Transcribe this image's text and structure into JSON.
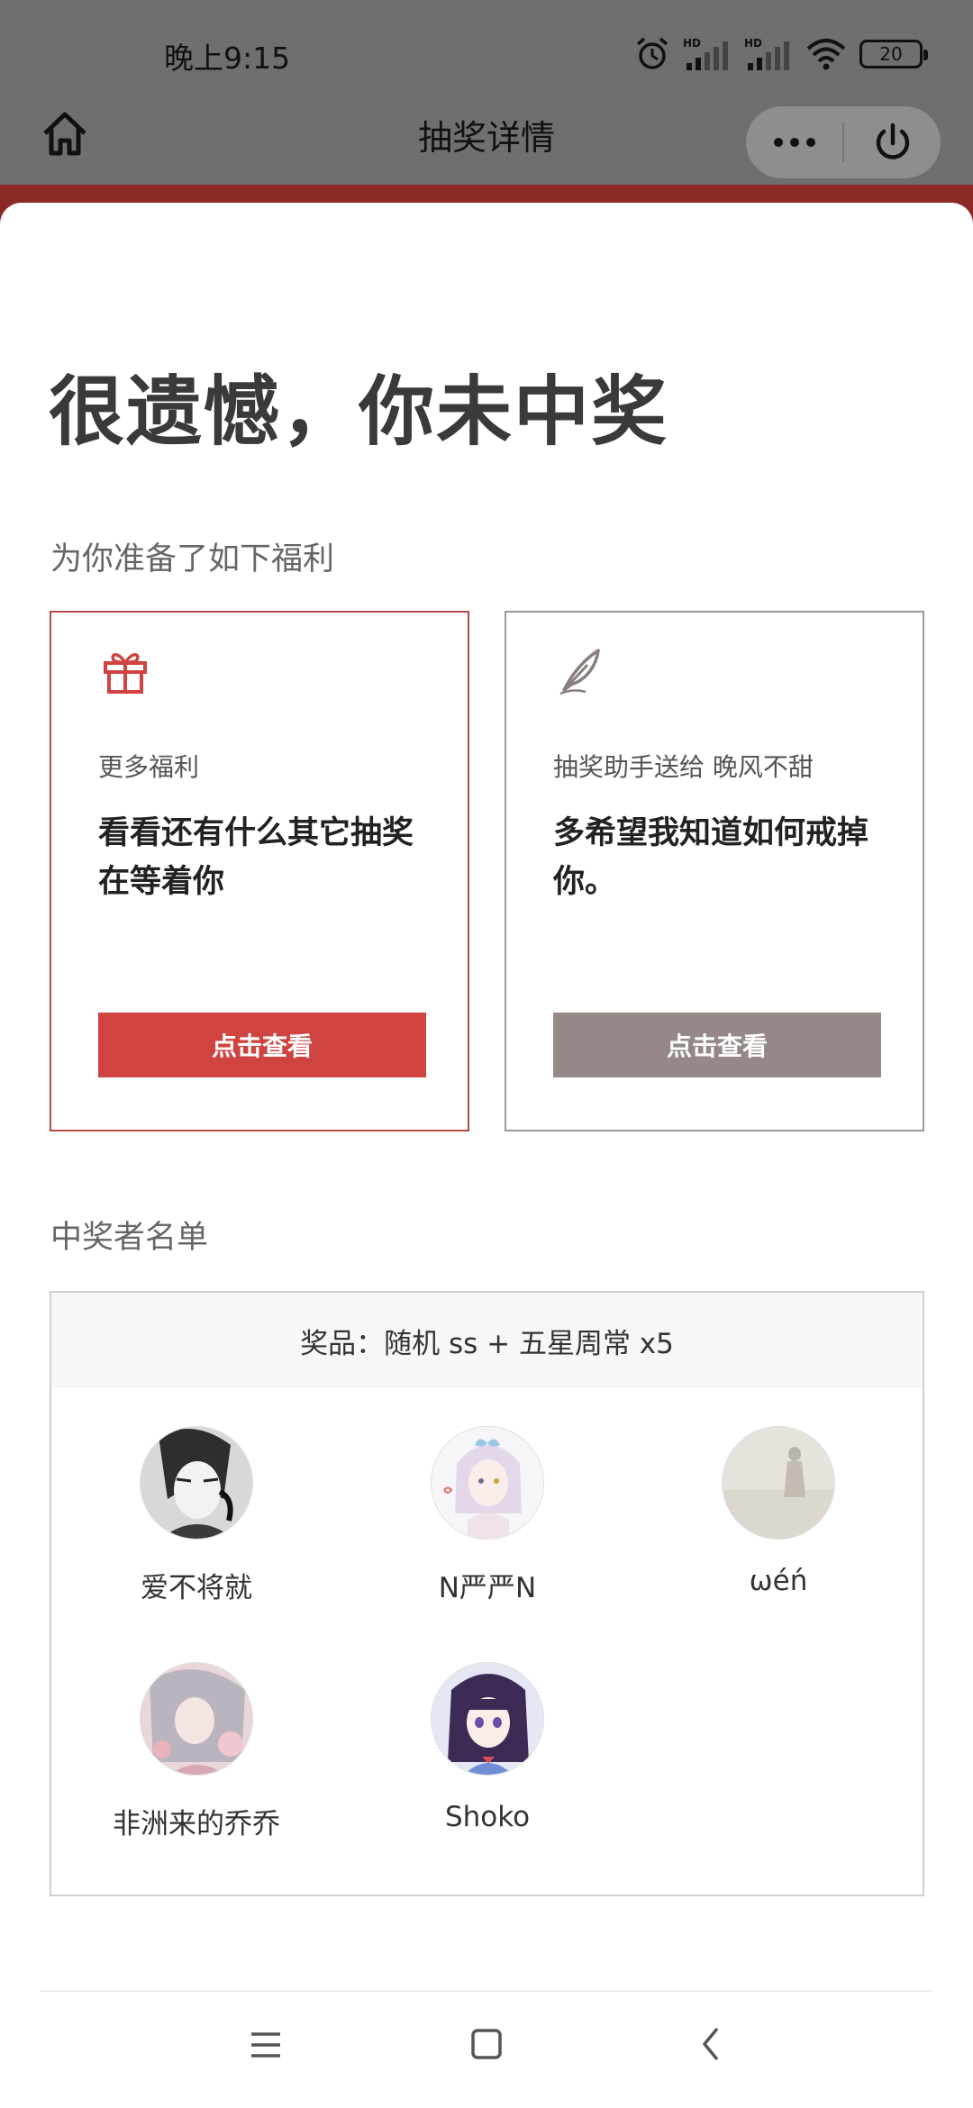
{
  "status_bar": {
    "time": "晚上9:15",
    "battery": "20",
    "icons": [
      "alarm-icon",
      "hd-signal-icon",
      "hd-signal-icon",
      "wifi-icon",
      "battery-icon"
    ]
  },
  "nav": {
    "title": "抽奖详情",
    "home_icon": "home-icon",
    "more_icon": "more-dots-icon",
    "close_icon": "power-icon"
  },
  "result": {
    "headline": "很遗憾，你未中奖"
  },
  "benefits": {
    "label": "为你准备了如下福利",
    "cards": [
      {
        "icon": "gift-icon",
        "subtitle": "更多福利",
        "text": "看看还有什么其它抽奖在等着你",
        "button": "点击查看",
        "accent": "#cf4441"
      },
      {
        "icon": "feather-icon",
        "subtitle": "抽奖助手送给 晚风不甜",
        "text": "多希望我知道如何戒掉你。",
        "button": "点击查看",
        "accent": "#958887"
      }
    ]
  },
  "winners": {
    "label": "中奖者名单",
    "prize": "奖品：随机 ss + 五星周常 x5",
    "list": [
      {
        "name": "爱不将就"
      },
      {
        "name": "N严严N"
      },
      {
        "name": "ωéń"
      },
      {
        "name": "非洲来的乔乔"
      },
      {
        "name": "Shoko"
      }
    ]
  },
  "system_nav": {
    "icons": [
      "menu-icon",
      "home-square-icon",
      "back-icon"
    ]
  }
}
